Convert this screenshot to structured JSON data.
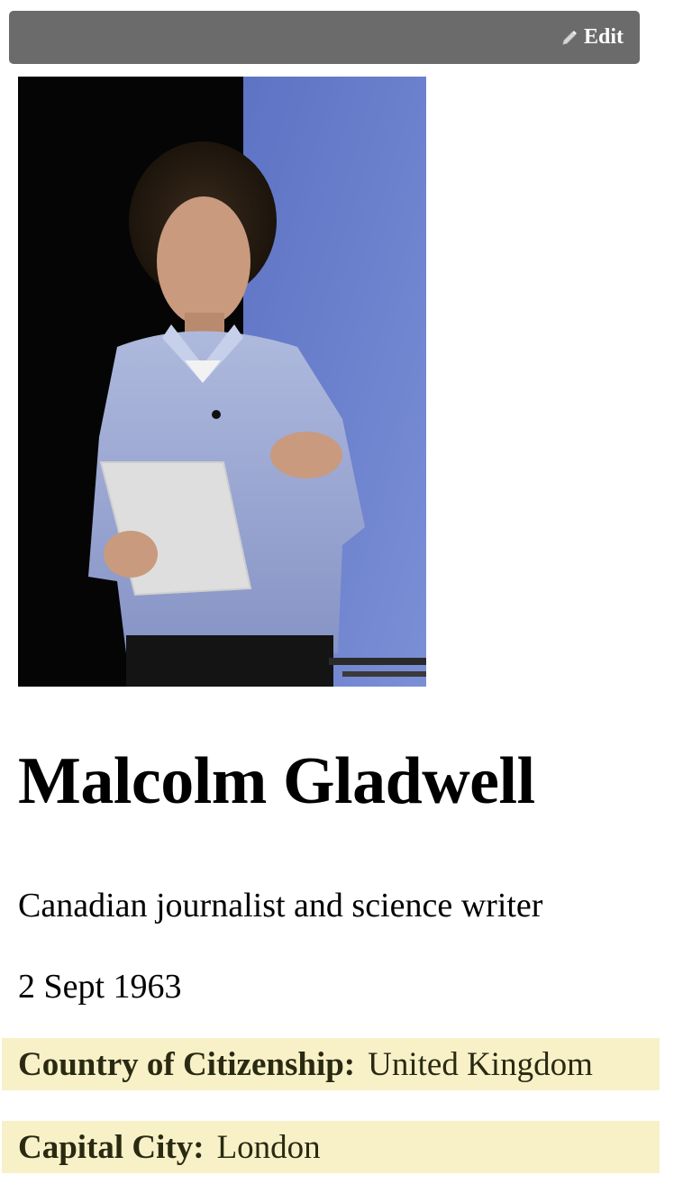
{
  "toolbar": {
    "edit_label": "Edit",
    "edit_icon": "pencil-icon"
  },
  "profile": {
    "photo_icon": "person-photo",
    "name": "Malcolm Gladwell",
    "description": "Canadian journalist and science writer",
    "birth_date": "2 Sept 1963"
  },
  "facts": {
    "country": {
      "label": "Country of Citizenship:",
      "value": "United Kingdom"
    },
    "capital": {
      "label": "Capital City:",
      "value": "London"
    }
  },
  "colors": {
    "edit_bar": "#6b6b6b",
    "fact_highlight": "#f8f1c8"
  }
}
